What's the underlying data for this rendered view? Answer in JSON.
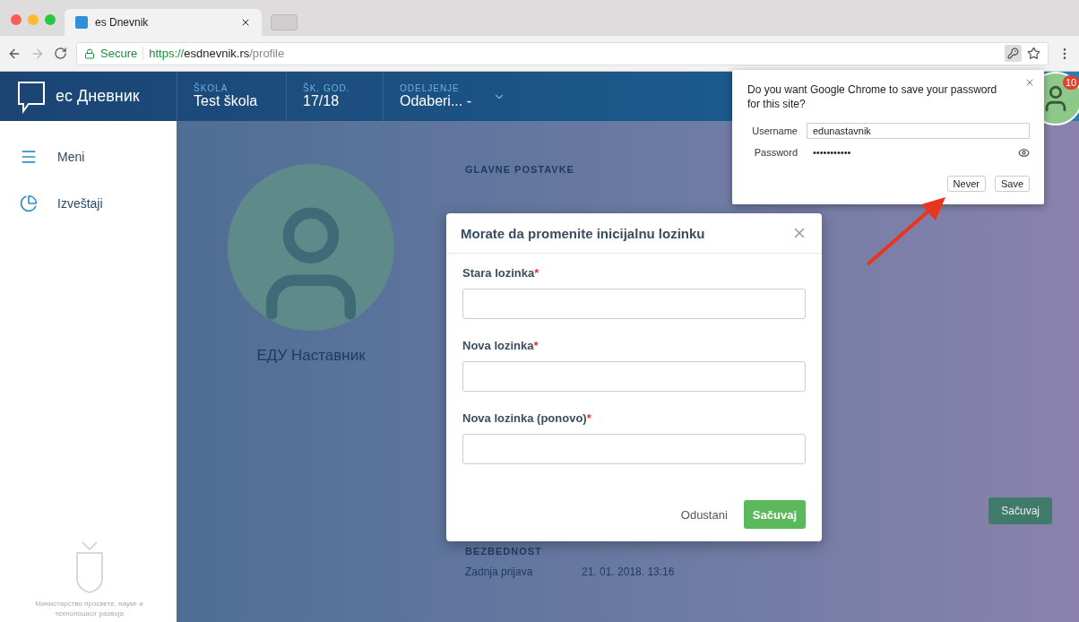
{
  "browser": {
    "tab_title": "es Dnevnik",
    "secure": "Secure",
    "url_scheme": "https://",
    "url_host": "esdnevnik.rs",
    "url_path": "/profile"
  },
  "header": {
    "logo_text": "ес Дневник",
    "fields": [
      {
        "label": "ŠKOLA",
        "value": "Test škola",
        "dropdown": false
      },
      {
        "label": "ŠK. GOD.",
        "value": "17/18",
        "dropdown": false
      },
      {
        "label": "ODELJENJE",
        "value": "Odaberi... -",
        "dropdown": true
      }
    ],
    "badge": "10"
  },
  "sidebar": {
    "items": [
      {
        "label": "Meni"
      },
      {
        "label": "Izveštaji"
      }
    ],
    "footer": "Министарство просвете, науке и технолошког развоја"
  },
  "profile": {
    "name": "ЕДУ Наставник"
  },
  "settings": {
    "main_heading": "GLAVNE POSTAVKE",
    "save": "Sačuvaj",
    "security_heading": "BEZBEDNOST",
    "last_login_label": "Zadnja prijava",
    "last_login_value": "21. 01. 2018. 13:16"
  },
  "modal": {
    "title": "Morate da promenite inicijalnu lozinku",
    "fields": [
      {
        "label": "Stara lozinka",
        "required_mark": "*"
      },
      {
        "label": "Nova lozinka",
        "required_mark": "*"
      },
      {
        "label": "Nova lozinka (ponovo)",
        "required_mark": "*"
      }
    ],
    "buttons": [
      {
        "label": "Odustani",
        "kind": "secondary"
      },
      {
        "label": "Sačuvaj",
        "kind": "primary"
      }
    ]
  },
  "password_prompt": {
    "question": "Do you want Google Chrome to save your password for this site?",
    "fields": [
      {
        "label": "Username",
        "value": "edunastavnik",
        "kind": "text"
      },
      {
        "label": "Password",
        "value": "•••••••••••",
        "kind": "password"
      }
    ],
    "buttons": [
      "Never",
      "Save"
    ]
  }
}
